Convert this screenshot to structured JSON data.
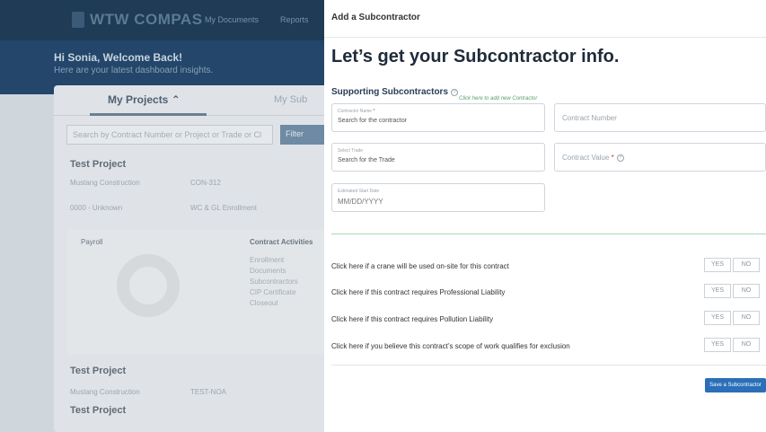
{
  "background": {
    "brand": "WTW COMPAS",
    "nav": [
      "My Documents",
      "Reports"
    ],
    "greeting": "Hi Sonia, Welcome Back!",
    "greeting_sub": "Here are your latest dashboard insights.",
    "tab_active": "My Projects",
    "tab_other": "My Sub",
    "search_placeholder": "Search by Contract Number or Project or Trade or Cl",
    "filter_label": "Filter",
    "projects": [
      {
        "title": "Test Project",
        "contractor": "Mustang Construction",
        "number": "CON-312",
        "status": "0000 - Unknown",
        "enrollment": "WC & GL Enrollment"
      },
      {
        "title": "Test Project",
        "contractor": "Mustang Construction",
        "number": "TEST-NOA"
      },
      {
        "title": "Test Project"
      }
    ],
    "payroll_label": "Payroll",
    "activities_label": "Contract Activities",
    "activities": [
      "Enrollment",
      "Documents",
      "Subcontractors",
      "CIP Certificate",
      "Closeout"
    ]
  },
  "modal": {
    "header_title": "Add a Subcontractor",
    "heading": "Let’s get your Subcontractor info.",
    "section_label": "Supporting Subcontractors",
    "add_link": "Click here to add new Contractor",
    "contractor_name_label": "Contractor Name",
    "contractor_name_value": "Search for the contractor",
    "contract_number_placeholder": "Contract Number",
    "trade_label": "Select Trade",
    "trade_value": "Search for the Trade",
    "contract_value_placeholder": "Contract Value",
    "start_date_label": "Estimated Start Date",
    "start_date_value": "MM/DD/YYYY",
    "questions": [
      "Click here if a crane will be used on-site for this contract",
      "Click here if this contract requires Professional Liability",
      "Click here if this contract requires Pollution Liability",
      "Click here if you believe this contract’s scope of work qualifies for exclusion"
    ],
    "yes_label": "YES",
    "no_label": "NO",
    "save_button": "Save a Subcontractor"
  },
  "colors": {
    "accent": "#2a6fb8",
    "success_divider": "#a9d8b4",
    "required": "#dd3333"
  }
}
